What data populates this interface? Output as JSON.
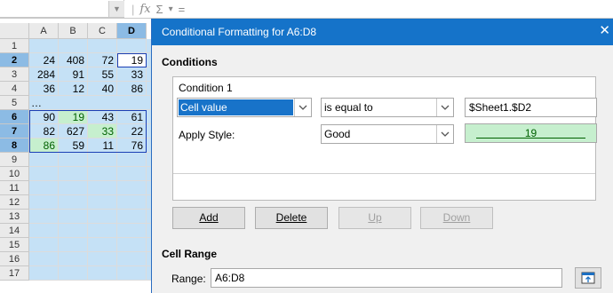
{
  "formula_bar": {
    "icons": [
      "function-wizard-icon",
      "sum-icon",
      "dropdown-icon",
      "formula-equals-icon"
    ],
    "fx_glyph": "fx",
    "sum_glyph": "Σ",
    "drop_glyph": "▾",
    "eq_glyph": "="
  },
  "sheet": {
    "columns": [
      "A",
      "B",
      "C",
      "D"
    ],
    "rows": [
      "1",
      "2",
      "3",
      "4",
      "5",
      "6",
      "7",
      "8",
      "9",
      "10",
      "11",
      "12",
      "13",
      "14",
      "15",
      "16",
      "17"
    ],
    "ellipsis": "…",
    "cells": {
      "r2": [
        "24",
        "408",
        "72",
        "19"
      ],
      "r3": [
        "284",
        "91",
        "55",
        "33"
      ],
      "r4": [
        "36",
        "12",
        "40",
        "86"
      ],
      "r6": [
        "90",
        "19",
        "43",
        "61"
      ],
      "r7": [
        "82",
        "627",
        "33",
        "22"
      ],
      "r8": [
        "86",
        "59",
        "11",
        "76"
      ]
    }
  },
  "dialog": {
    "title": "Conditional Formatting for A6:D8",
    "close_glyph": "✕",
    "conditions_heading": "Conditions",
    "condition_label": "Condition 1",
    "type_combo_value": "Cell value",
    "operator_combo_value": "is equal to",
    "value_field": "$Sheet1.$D2",
    "apply_style_label": "Apply Style:",
    "style_combo_value": "Good",
    "style_preview_text": "19",
    "buttons": {
      "add": "Add",
      "delete": "Delete",
      "up": "Up",
      "down": "Down"
    },
    "cell_range_heading": "Cell Range",
    "range_label": "Range:",
    "range_value": "A6:D8"
  }
}
